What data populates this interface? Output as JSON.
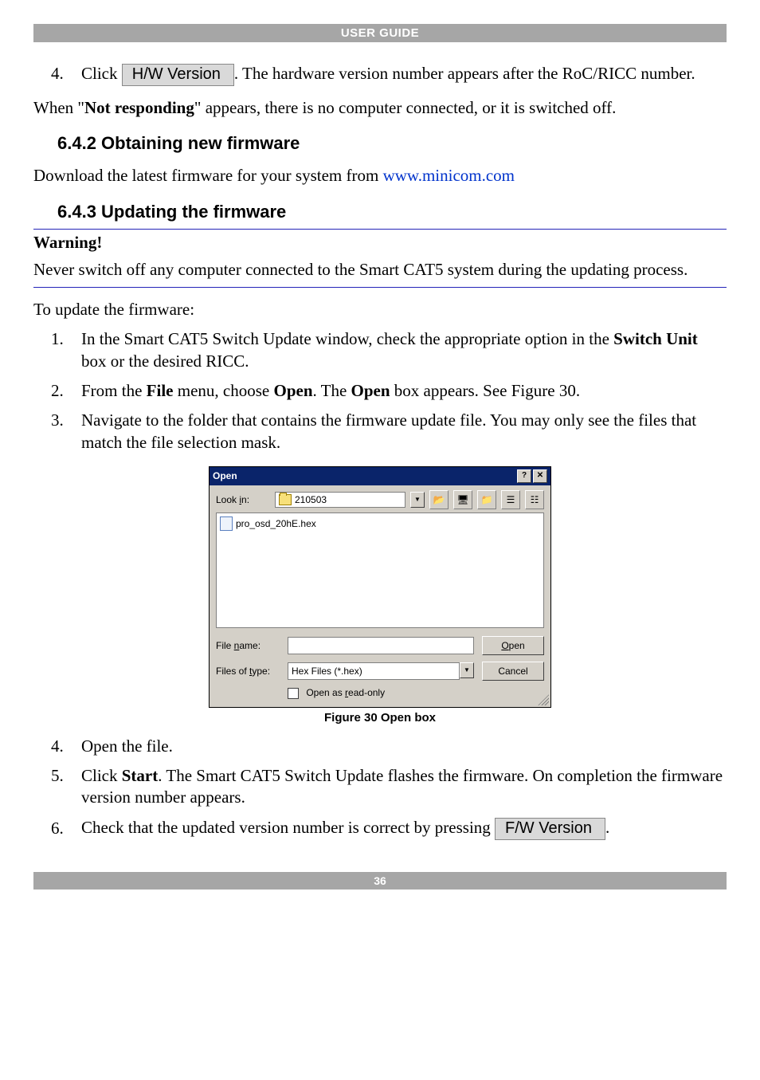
{
  "header": {
    "title": "USER GUIDE"
  },
  "step4": {
    "num": "4.",
    "pre": "Click ",
    "btn": "H/W Version",
    "post": ". The hardware version number appears after the RoC/RICC number."
  },
  "not_responding": {
    "pre": "When \"",
    "bold": "Not responding",
    "post": "\" appears, there is no computer connected, or it is switched off."
  },
  "sec642": {
    "title": "6.4.2 Obtaining new firmware"
  },
  "download": {
    "pre": "Download the latest firmware for your system from ",
    "link": "www.minicom.com"
  },
  "sec643": {
    "title": "6.4.3 Updating the firmware"
  },
  "warning": {
    "head": "Warning!",
    "body": "Never switch off any computer connected to the Smart CAT5 system during the updating process."
  },
  "to_update": "To update the firmware:",
  "steps": {
    "s1": {
      "num": "1.",
      "pre": "In the Smart CAT5 Switch Update window, check the appropriate option in the ",
      "bold": "Switch Unit",
      "post": " box or the desired RICC."
    },
    "s2": {
      "num": "2.",
      "a": "From the ",
      "b": "File",
      "c": " menu, choose ",
      "d": "Open",
      "e": ". The ",
      "f": "Open",
      "g": " box appears. See Figure 30."
    },
    "s3": {
      "num": "3.",
      "text": "Navigate to the folder that contains the firmware update file. You may only see the files that match the file selection mask."
    },
    "s4": {
      "num": "4.",
      "text": "Open the file."
    },
    "s5": {
      "num": "5.",
      "a": "Click ",
      "b": "Start",
      "c": ". The Smart CAT5 Switch Update flashes the firmware. On completion the firmware version number appears."
    },
    "s6": {
      "num": "6.",
      "pre": "Check that the updated version number is correct by pressing ",
      "btn": "F/W Version",
      "post": "."
    }
  },
  "dialog": {
    "title": "Open",
    "help": "?",
    "close": "✕",
    "lookin_label_pre": "Look ",
    "lookin_label_u": "i",
    "lookin_label_post": "n:",
    "lookin_value": "210503",
    "file_item": "pro_osd_20hE.hex",
    "filename_label_pre": "File ",
    "filename_label_u": "n",
    "filename_label_post": "ame:",
    "filename_value": "",
    "filetype_label_pre": "Files of ",
    "filetype_label_u": "t",
    "filetype_label_post": "ype:",
    "filetype_value": "Hex Files (*.hex)",
    "readonly_pre": "Open as ",
    "readonly_u": "r",
    "readonly_post": "ead-only",
    "open_btn_u": "O",
    "open_btn_post": "pen",
    "cancel_btn": "Cancel"
  },
  "figure_caption": "Figure 30 Open box",
  "footer": {
    "page": "36"
  }
}
